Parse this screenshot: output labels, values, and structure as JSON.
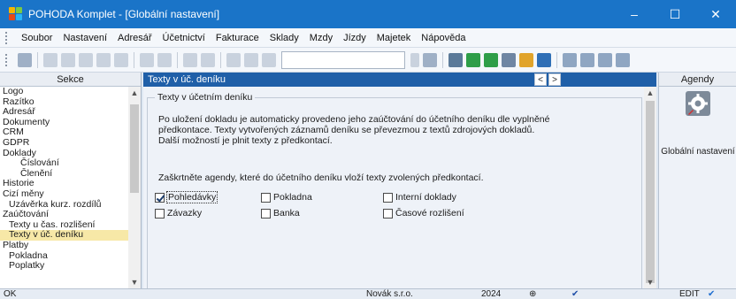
{
  "window": {
    "title": "POHODA Komplet - [Globální nastavení]",
    "controls": {
      "minimize": "–",
      "maximize": "☐",
      "close": "✕"
    }
  },
  "menu": [
    "Soubor",
    "Nastavení",
    "Adresář",
    "Účetnictví",
    "Fakturace",
    "Sklady",
    "Mzdy",
    "Jízdy",
    "Majetek",
    "Nápověda"
  ],
  "sekce": {
    "header": "Sekce",
    "items": [
      {
        "label": "Logo",
        "level": 0
      },
      {
        "label": "Razítko",
        "level": 0
      },
      {
        "label": "Adresář",
        "level": 0
      },
      {
        "label": "Dokumenty",
        "level": 0
      },
      {
        "label": "CRM",
        "level": 0
      },
      {
        "label": "GDPR",
        "level": 0
      },
      {
        "label": "Doklady",
        "level": 0
      },
      {
        "label": "Číslování",
        "level": 2
      },
      {
        "label": "Členění",
        "level": 2
      },
      {
        "label": "Historie",
        "level": 0
      },
      {
        "label": "Cizí měny",
        "level": 0
      },
      {
        "label": "Uzávěrka kurz. rozdílů",
        "level": 1
      },
      {
        "label": "Zaúčtování",
        "level": 0
      },
      {
        "label": "Texty u čas. rozlišení",
        "level": 1
      },
      {
        "label": "Texty v úč. deníku",
        "level": 1,
        "selected": true
      },
      {
        "label": "Platby",
        "level": 0
      },
      {
        "label": "Pokladna",
        "level": 1
      },
      {
        "label": "Poplatky",
        "level": 1
      }
    ]
  },
  "main": {
    "tab_title": "Texty v úč. deníku",
    "nav_prev": "<",
    "nav_next": ">",
    "group_title": "Texty v účetním deníku",
    "paragraph1": [
      "Po uložení dokladu je automaticky provedeno jeho zaúčtování do účetního deníku dle vyplněné",
      "předkontace. Texty vytvořených záznamů deníku se převezmou z textů zdrojových dokladů.",
      "Další možností je plnit texty z předkontací."
    ],
    "paragraph2": "Zaškrtněte agendy, které do účetního deníku vloží texty zvolených předkontací.",
    "checkboxes": [
      {
        "label": "Pohledávky",
        "checked": true
      },
      {
        "label": "Pokladna",
        "checked": false
      },
      {
        "label": "Interní doklady",
        "checked": false
      },
      {
        "label": "Závazky",
        "checked": false
      },
      {
        "label": "Banka",
        "checked": false
      },
      {
        "label": "Časové rozlišení",
        "checked": false
      }
    ]
  },
  "agendy": {
    "header": "Agendy",
    "item_label": "Globální nastavení",
    "icon": "gear-icon"
  },
  "status": {
    "left": "OK",
    "company": "Novák s.r.o.",
    "year": "2024",
    "mode": "EDIT"
  },
  "colors": {
    "titlebar": "#1a74c8",
    "tabbar": "#1f5fa8",
    "selected_item": "#f7e8a7"
  }
}
